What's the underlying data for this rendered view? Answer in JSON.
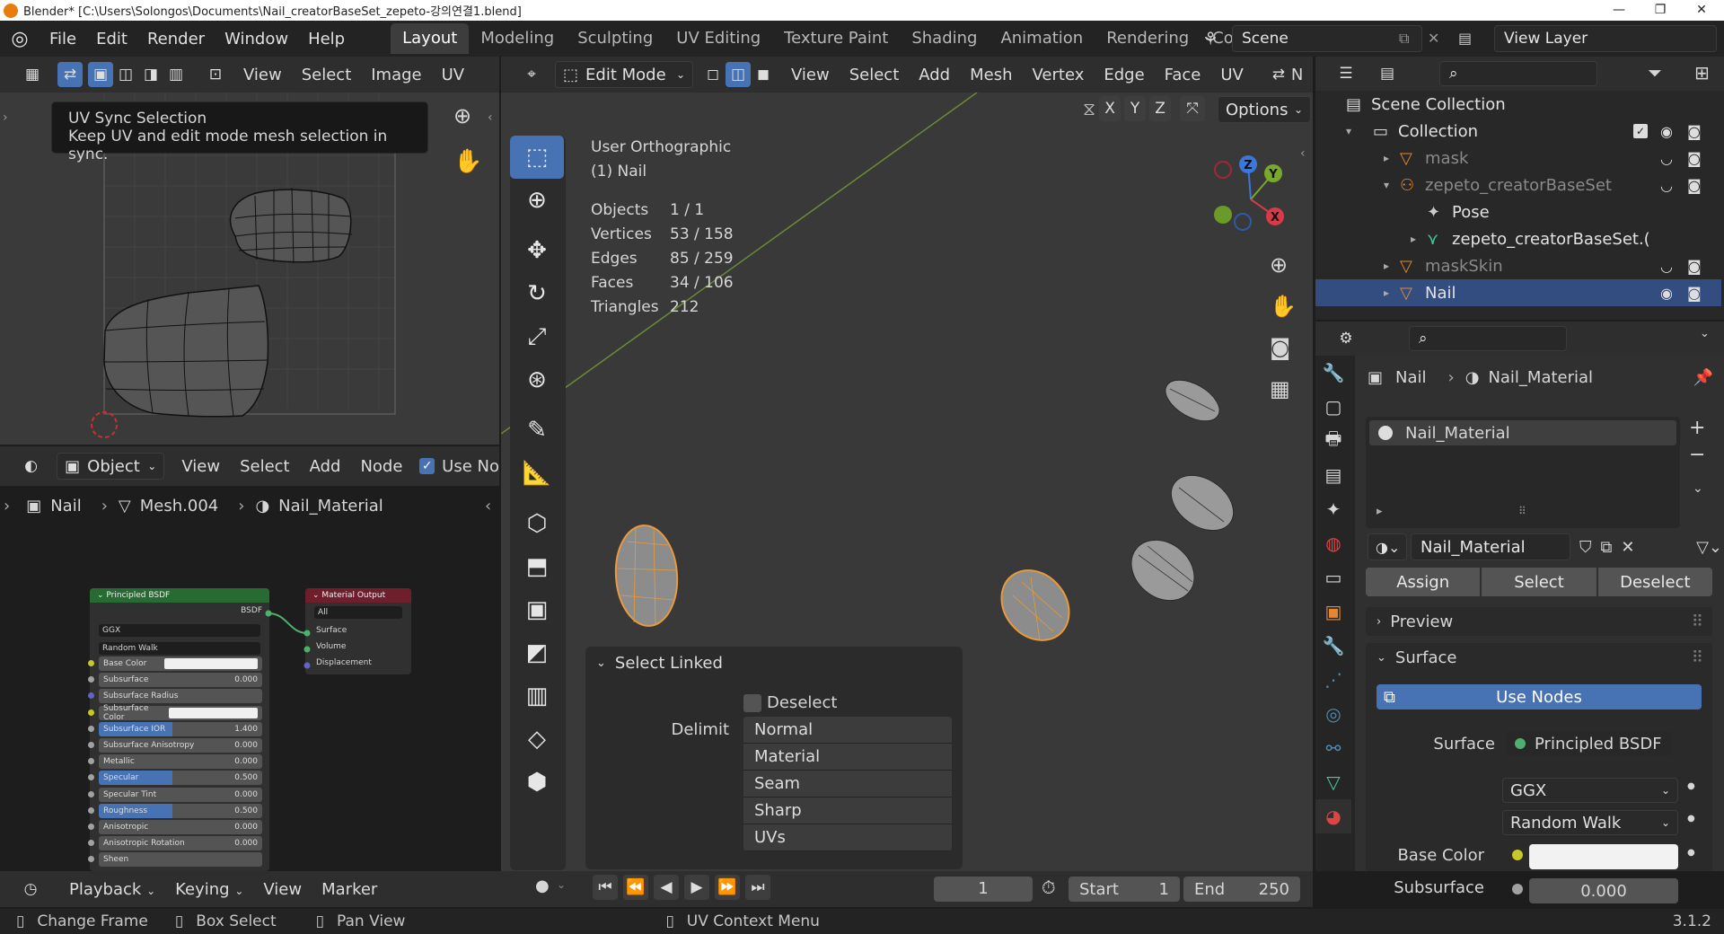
{
  "window": {
    "title": "Blender* [C:\\Users\\Solongos\\Documents\\Nail_creatorBaseSet_zepeto-강의연결1.blend]",
    "minimize": "—",
    "maximize": "❐",
    "close": "✕"
  },
  "menu": [
    "File",
    "Edit",
    "Render",
    "Window",
    "Help"
  ],
  "workspaces": [
    "Layout",
    "Modeling",
    "Sculpting",
    "UV Editing",
    "Texture Paint",
    "Shading",
    "Animation",
    "Rendering",
    "Compo"
  ],
  "scene": {
    "name": "Scene"
  },
  "view_layer": {
    "name": "View Layer"
  },
  "uv_editor": {
    "menus": [
      "View",
      "Select",
      "Image",
      "UV"
    ],
    "tooltip_title": "UV Sync Selection",
    "tooltip_body": "Keep UV and edit mode mesh selection in sync."
  },
  "node_editor": {
    "object_dropdown": "Object",
    "menus": [
      "View",
      "Select",
      "Add",
      "Node"
    ],
    "use_nodes": "Use No",
    "breadcrumb": [
      "Nail",
      "Mesh.004",
      "Nail_Material"
    ],
    "bsdf": {
      "title": "Principled BSDF",
      "output": "BSDF",
      "dist": "GGX",
      "sss": "Random Walk",
      "rows": [
        {
          "label": "Base Color",
          "value": "",
          "type": "color"
        },
        {
          "label": "Subsurface",
          "value": "0.000",
          "type": "num"
        },
        {
          "label": "Subsurface Radius",
          "value": "",
          "type": "vec"
        },
        {
          "label": "Subsurface Color",
          "value": "",
          "type": "color"
        },
        {
          "label": "Subsurface IOR",
          "value": "1.400",
          "type": "blue"
        },
        {
          "label": "Subsurface Anisotropy",
          "value": "0.000",
          "type": "num"
        },
        {
          "label": "Metallic",
          "value": "0.000",
          "type": "num"
        },
        {
          "label": "Specular",
          "value": "0.500",
          "type": "blue"
        },
        {
          "label": "Specular Tint",
          "value": "0.000",
          "type": "num"
        },
        {
          "label": "Roughness",
          "value": "0.500",
          "type": "blue"
        },
        {
          "label": "Anisotropic",
          "value": "0.000",
          "type": "num"
        },
        {
          "label": "Anisotropic Rotation",
          "value": "0.000",
          "type": "num"
        },
        {
          "label": "Sheen",
          "value": "",
          "type": "num"
        }
      ]
    },
    "output": {
      "title": "Material Output",
      "target": "All",
      "sockets": [
        "Surface",
        "Volume",
        "Displacement"
      ]
    }
  },
  "viewport": {
    "mode": "Edit Mode",
    "menus": [
      "View",
      "Select",
      "Add",
      "Mesh",
      "Vertex",
      "Edge",
      "Face",
      "UV"
    ],
    "cut": "N",
    "axes": [
      "X",
      "Y",
      "Z"
    ],
    "options": "Options",
    "view_name": "User Orthographic",
    "object_name": "(1) Nail",
    "stats": [
      {
        "label": "Objects",
        "value": "1 / 1"
      },
      {
        "label": "Vertices",
        "value": "53 / 158"
      },
      {
        "label": "Edges",
        "value": "85 / 259"
      },
      {
        "label": "Faces",
        "value": "34 / 106"
      },
      {
        "label": "Triangles",
        "value": "212"
      }
    ],
    "gizmo": {
      "z": "Z",
      "y": "Y",
      "x": "X"
    },
    "operator": {
      "title": "Select Linked",
      "deselect": "Deselect",
      "delimit_label": "Delimit",
      "delimit_options": [
        "Normal",
        "Material",
        "Seam",
        "Sharp",
        "UVs"
      ]
    }
  },
  "outliner": {
    "items": [
      {
        "label": "Scene Collection",
        "indent": 0
      },
      {
        "label": "Collection",
        "indent": 1
      },
      {
        "label": "mask",
        "indent": 2
      },
      {
        "label": "zepeto_creatorBaseSet",
        "indent": 2
      },
      {
        "label": "Pose",
        "indent": 3
      },
      {
        "label": "zepeto_creatorBaseSet.(",
        "indent": 3
      },
      {
        "label": "maskSkin",
        "indent": 2
      },
      {
        "label": "Nail",
        "indent": 2
      }
    ]
  },
  "properties": {
    "breadcrumb_obj": "Nail",
    "breadcrumb_mat": "Nail_Material",
    "slot": "Nail_Material",
    "material_name": "Nail_Material",
    "assign": "Assign",
    "select": "Select",
    "deselect": "Deselect",
    "preview": "Preview",
    "surface_panel": "Surface",
    "use_nodes": "Use Nodes",
    "surface_label": "Surface",
    "surface_value": "Principled BSDF",
    "dist": "GGX",
    "sss": "Random Walk",
    "base_color_label": "Base Color",
    "subsurface_label": "Subsurface",
    "subsurface_value": "0.000"
  },
  "timeline": {
    "menus": [
      "Playback",
      "Keying",
      "View",
      "Marker"
    ],
    "frame": "1",
    "start_label": "Start",
    "start": "1",
    "end_label": "End",
    "end": "250"
  },
  "statusbar": {
    "items": [
      "Change Frame",
      "Box Select",
      "Pan View",
      "UV Context Menu"
    ],
    "version": "3.1.2"
  },
  "colors": {
    "accent": "#4772b3",
    "selected_orange": "#e89a3c",
    "header": "#2e2e2e",
    "panel": "#303030"
  }
}
